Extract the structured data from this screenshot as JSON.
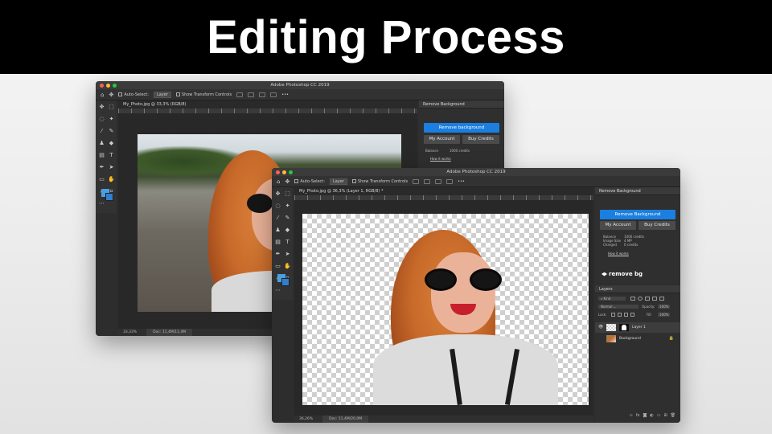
{
  "banner": {
    "title": "Editing Process"
  },
  "app": {
    "title": "Adobe Photoshop CC 2019"
  },
  "colors": {
    "accent": "#1a7fe0",
    "bg": "#2d2d2d",
    "hair": "#c86a2a"
  },
  "back_window": {
    "options": {
      "auto_select": "Auto-Select:",
      "layer_select": "Layer",
      "transform": "Show Transform Controls"
    },
    "tab": "My_Photo.jpg @ 33,3% (RGB/8)",
    "status": {
      "zoom": "33,33%",
      "doc": "Doc: 11,4M/11,4M"
    },
    "plugin": {
      "header": "Remove Background",
      "remove_btn": "Remove background",
      "my_account": "My Account",
      "buy_credits": "Buy Credits",
      "balance_label": "Balance",
      "balance_value": "1000 credits",
      "how_it_works": "How it works"
    }
  },
  "front_window": {
    "options": {
      "auto_select": "Auto-Select:",
      "layer_select": "Layer",
      "transform": "Show Transform Controls"
    },
    "tab": "My_Photo.jpg @ 36,3% (Layer 1, RGB/8) *",
    "status": {
      "zoom": "36,26%",
      "doc": "Doc: 11,4M/20,0M"
    },
    "plugin": {
      "header": "Remove Background",
      "remove_btn": "Remove Background",
      "my_account": "My Account",
      "buy_credits": "Buy Credits",
      "info_labels": [
        "Balance",
        "Image Size",
        "Charged"
      ],
      "info_values": [
        "1000 credits",
        "4 MP",
        "0 credits"
      ],
      "how_it_works": "How it works",
      "brand": "remove bg"
    },
    "layers": {
      "header": "Layers",
      "kind": "Kind",
      "blend_mode": "Normal",
      "opacity_label": "Opacity:",
      "opacity_value": "100%",
      "lock_label": "Lock:",
      "fill_label": "Fill:",
      "fill_value": "100%",
      "items": [
        "Layer 1",
        "Background"
      ]
    }
  },
  "icons": [
    "move-icon",
    "marquee-icon",
    "lasso-icon",
    "wand-icon",
    "crop-icon",
    "eyedropper-icon",
    "brush-icon",
    "stamp-icon",
    "eraser-icon",
    "gradient-icon",
    "pen-icon",
    "type-icon",
    "path-select-icon",
    "rectangle-icon",
    "hand-icon",
    "zoom-icon"
  ]
}
